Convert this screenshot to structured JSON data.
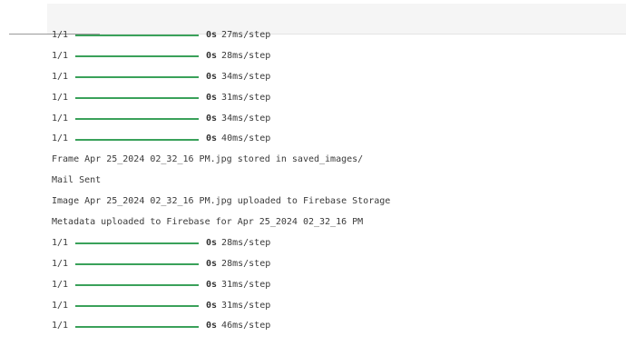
{
  "output": {
    "progress_lines_top": [
      {
        "count": "1/1",
        "secs": "0s",
        "rate": "27ms/step"
      },
      {
        "count": "1/1",
        "secs": "0s",
        "rate": "28ms/step"
      },
      {
        "count": "1/1",
        "secs": "0s",
        "rate": "34ms/step"
      },
      {
        "count": "1/1",
        "secs": "0s",
        "rate": "31ms/step"
      },
      {
        "count": "1/1",
        "secs": "0s",
        "rate": "34ms/step"
      },
      {
        "count": "1/1",
        "secs": "0s",
        "rate": "40ms/step"
      }
    ],
    "messages": [
      "Frame Apr 25_2024 02_32_16 PM.jpg stored in saved_images/",
      "Mail Sent",
      "Image Apr 25_2024 02_32_16 PM.jpg uploaded to Firebase Storage",
      "Metadata uploaded to Firebase for Apr 25_2024 02_32_16 PM"
    ],
    "progress_lines_bottom": [
      {
        "count": "1/1",
        "secs": "0s",
        "rate": "28ms/step"
      },
      {
        "count": "1/1",
        "secs": "0s",
        "rate": "28ms/step"
      },
      {
        "count": "1/1",
        "secs": "0s",
        "rate": "31ms/step"
      },
      {
        "count": "1/1",
        "secs": "0s",
        "rate": "31ms/step"
      },
      {
        "count": "1/1",
        "secs": "0s",
        "rate": "46ms/step"
      }
    ],
    "progress_color": "#3aa15a"
  }
}
